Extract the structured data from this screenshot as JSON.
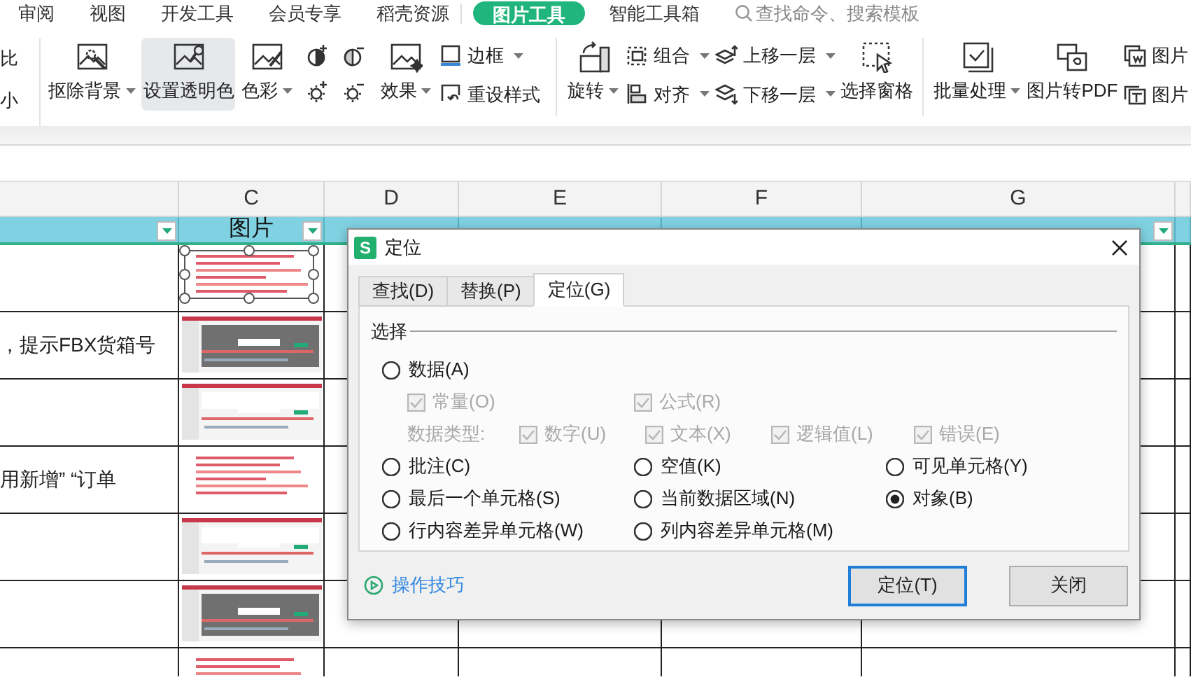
{
  "menu_tabs": [
    {
      "label": "审阅",
      "selected": false
    },
    {
      "label": "视图",
      "selected": false
    },
    {
      "label": "开发工具",
      "selected": false
    },
    {
      "label": "会员专享",
      "selected": false
    },
    {
      "label": "稻壳资源",
      "selected": false
    },
    {
      "label": "图片工具",
      "selected": true
    },
    {
      "label": "智能工具箱",
      "selected": false
    }
  ],
  "search": {
    "placeholder": "查找命令、搜索模板"
  },
  "ribbon": {
    "items": [
      {
        "kind": "fragment",
        "rows": [
          "比",
          "小"
        ]
      },
      {
        "kind": "large",
        "label": "抠除背景",
        "dropdown": true,
        "highlighted": false
      },
      {
        "kind": "large",
        "label": "设置透明色",
        "dropdown": false,
        "highlighted": true
      },
      {
        "kind": "large",
        "label": "色彩",
        "dropdown": true,
        "highlighted": false
      },
      {
        "kind": "icon_grid"
      },
      {
        "kind": "large",
        "label": "效果",
        "dropdown": true,
        "highlighted": false
      },
      {
        "kind": "pair",
        "rows": [
          {
            "label": "边框",
            "dropdown": true
          },
          {
            "label": "重设样式",
            "dropdown": false
          }
        ]
      },
      {
        "kind": "separator"
      },
      {
        "kind": "large",
        "label": "旋转",
        "dropdown": true,
        "highlighted": false
      },
      {
        "kind": "pair",
        "rows": [
          {
            "label": "组合",
            "dropdown": true
          },
          {
            "label": "对齐",
            "dropdown": true
          }
        ]
      },
      {
        "kind": "pair",
        "rows": [
          {
            "label": "上移一层",
            "dropdown": true
          },
          {
            "label": "下移一层",
            "dropdown": true
          }
        ]
      },
      {
        "kind": "large",
        "label": "选择窗格",
        "dropdown": false,
        "highlighted": false
      },
      {
        "kind": "separator"
      },
      {
        "kind": "large",
        "label": "批量处理",
        "dropdown": true,
        "highlighted": false
      },
      {
        "kind": "large",
        "label": "图片转PDF",
        "dropdown": false,
        "highlighted": false
      },
      {
        "kind": "pair",
        "rows": [
          {
            "label": "图片",
            "dropdown": false
          },
          {
            "label": "图片",
            "dropdown": false
          }
        ]
      }
    ]
  },
  "sheet": {
    "columns": [
      "C",
      "D",
      "E",
      "F",
      "G"
    ],
    "filter_row": [
      {
        "filter": true
      },
      {
        "label": "图片",
        "filter": true
      },
      {
        "filter": false
      },
      {
        "filter": false
      },
      {
        "filter": false
      },
      {
        "filter": true
      },
      {
        "filter": false
      }
    ],
    "rows": [
      {
        "image": {
          "kind": "picture",
          "selected": true
        }
      },
      {
        "text": "，提示FBX货箱号",
        "image": {
          "kind": "picture",
          "selected": false
        }
      },
      {
        "image": {
          "kind": "picture",
          "selected": false
        }
      },
      {
        "text": "用新增”  “订单",
        "image": {
          "kind": "picture",
          "selected": false
        }
      },
      {
        "image": {
          "kind": "picture",
          "selected": false
        }
      },
      {
        "image": {
          "kind": "picture",
          "selected": false
        }
      },
      {
        "image": {
          "kind": "picture",
          "selected": false
        }
      }
    ]
  },
  "dialog": {
    "logo_letter": "S",
    "title": "定位",
    "tabs": [
      {
        "label": "查找(D)",
        "selected": false
      },
      {
        "label": "替换(P)",
        "selected": false
      },
      {
        "label": "定位(G)",
        "selected": true
      }
    ],
    "group_label": "选择",
    "option_rows": [
      [
        {
          "kind": "radio",
          "label": "数据(A)",
          "selected": false
        }
      ],
      [
        {
          "kind": "checkbox",
          "label": "常量(O)",
          "checked": true,
          "disabled": true
        },
        {
          "kind": "checkbox",
          "label": "公式(R)",
          "checked": true,
          "disabled": true
        }
      ],
      [
        {
          "kind": "text",
          "label": "数据类型:",
          "disabled": true
        },
        {
          "kind": "checkbox",
          "label": "数字(U)",
          "checked": true,
          "disabled": true
        },
        {
          "kind": "checkbox",
          "label": "文本(X)",
          "checked": true,
          "disabled": true
        },
        {
          "kind": "checkbox",
          "label": "逻辑值(L)",
          "checked": true,
          "disabled": true
        },
        {
          "kind": "checkbox",
          "label": "错误(E)",
          "checked": true,
          "disabled": true
        }
      ],
      [
        {
          "kind": "radio",
          "label": "批注(C)",
          "selected": false
        },
        {
          "kind": "radio",
          "label": "空值(K)",
          "selected": false
        },
        {
          "kind": "radio",
          "label": "可见单元格(Y)",
          "selected": false
        }
      ],
      [
        {
          "kind": "radio",
          "label": "最后一个单元格(S)",
          "selected": false
        },
        {
          "kind": "radio",
          "label": "当前数据区域(N)",
          "selected": false
        },
        {
          "kind": "radio",
          "label": "对象(B)",
          "selected": true
        }
      ],
      [
        {
          "kind": "radio",
          "label": "行内容差异单元格(W)",
          "selected": false
        },
        {
          "kind": "radio",
          "label": "列内容差异单元格(M)",
          "selected": false
        }
      ]
    ],
    "tips_link": "操作技巧",
    "buttons": [
      {
        "label": "定位(T)",
        "default": true
      },
      {
        "label": "关闭",
        "default": false
      }
    ]
  }
}
